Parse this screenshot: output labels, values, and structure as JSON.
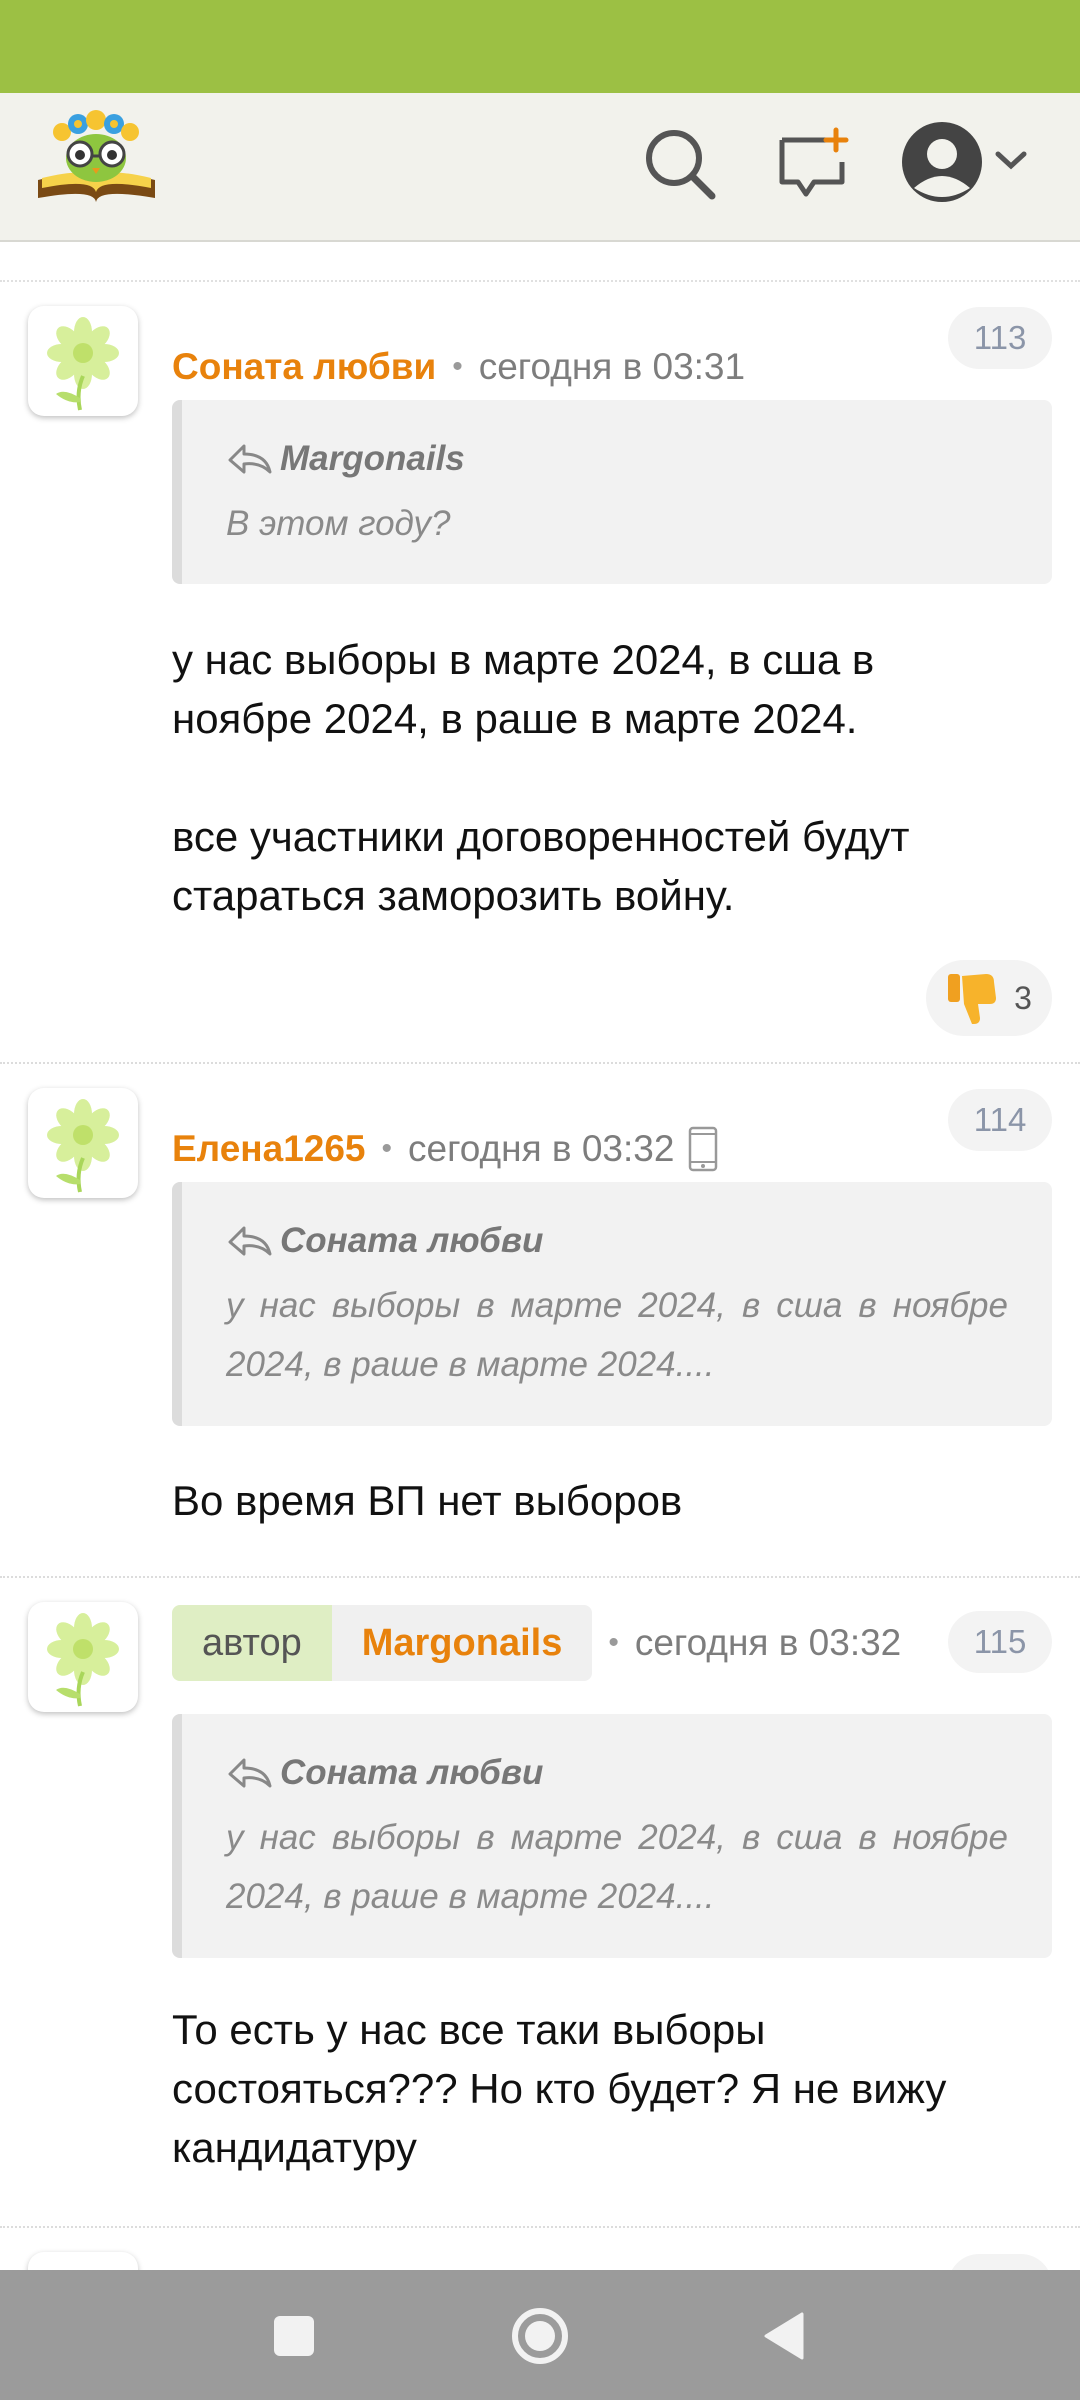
{
  "header": {
    "logo_icon": "reading-owl-logo-icon",
    "search_icon": "search-icon",
    "new_topic_icon": "new-message-icon",
    "profile_icon": "user-avatar-icon",
    "colors": {
      "status_bar": "#9cc044",
      "header_bg": "#f2f2ec",
      "accent": "#e8820c"
    }
  },
  "comments": [
    {
      "author": "Соната любви",
      "time": "сегодня в 03:31",
      "number": "113",
      "quote": {
        "author": "Margonails",
        "text": "В этом году?"
      },
      "text_lines": [
        "у нас выборы в марте 2024, в сша в",
        "ноябре 2024, в раше в марте 2024.",
        "",
        "все участники договоренностей будут",
        "стараться заморозить войну."
      ],
      "reaction": {
        "icon": "thumbs-down-icon",
        "count": "3"
      }
    },
    {
      "author": "Елена1265",
      "time": "сегодня в 03:32",
      "device_icon": "mobile-phone-icon",
      "number": "114",
      "quote": {
        "author": "Соната любви",
        "text_lines": [
          "у нас выборы в марте 2024, в сша в ноябре",
          "2024, в раше в марте 2024...."
        ]
      },
      "text": "Во время ВП нет выборов"
    },
    {
      "role_badge": "автор",
      "author": "Margonails",
      "time": "сегодня в 03:32",
      "number": "115",
      "quote": {
        "author": "Соната любви",
        "text_lines": [
          "у нас выборы в марте 2024, в сша в ноябре",
          "2024, в раше в марте 2024...."
        ]
      },
      "text_lines": [
        "То есть у нас все таки выборы",
        "состояться??? Но кто будет? Я не вижу",
        "кандидатуру"
      ]
    }
  ],
  "navbar": {
    "recents_icon": "square-recents-icon",
    "home_icon": "circle-home-icon",
    "back_icon": "triangle-back-icon"
  }
}
